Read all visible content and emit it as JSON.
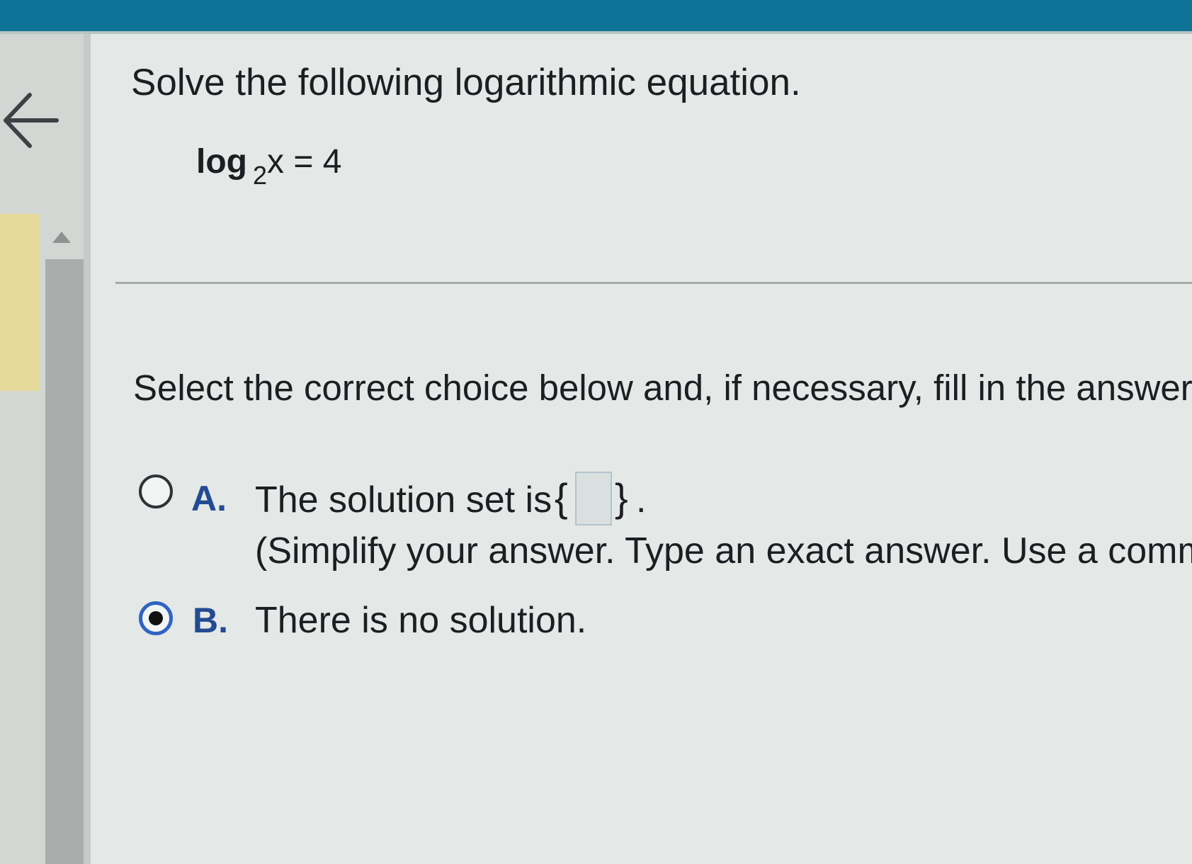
{
  "question": {
    "title": "Solve the following logarithmic equation.",
    "equation": {
      "log": "log",
      "base": "2",
      "rest": "x = 4"
    }
  },
  "instruction": "Select the correct choice below and, if necessary, fill in the answer",
  "choices": [
    {
      "letter": "A.",
      "text": "The solution set is",
      "brace_open": "{",
      "brace_close": "}",
      "period": ".",
      "answer_value": "",
      "hint": "(Simplify your answer. Type an exact answer. Use a comma",
      "selected": false
    },
    {
      "letter": "B.",
      "text": "There is no solution.",
      "selected": true
    }
  ],
  "icons": {
    "back": "back-arrow-icon",
    "scroll_up": "scroll-up-arrow-icon"
  },
  "colors": {
    "top_bar": "#0e7397",
    "selected_radio": "#2f64c4",
    "choice_letter": "#234a92",
    "progress_marker": "#e5d99a"
  }
}
